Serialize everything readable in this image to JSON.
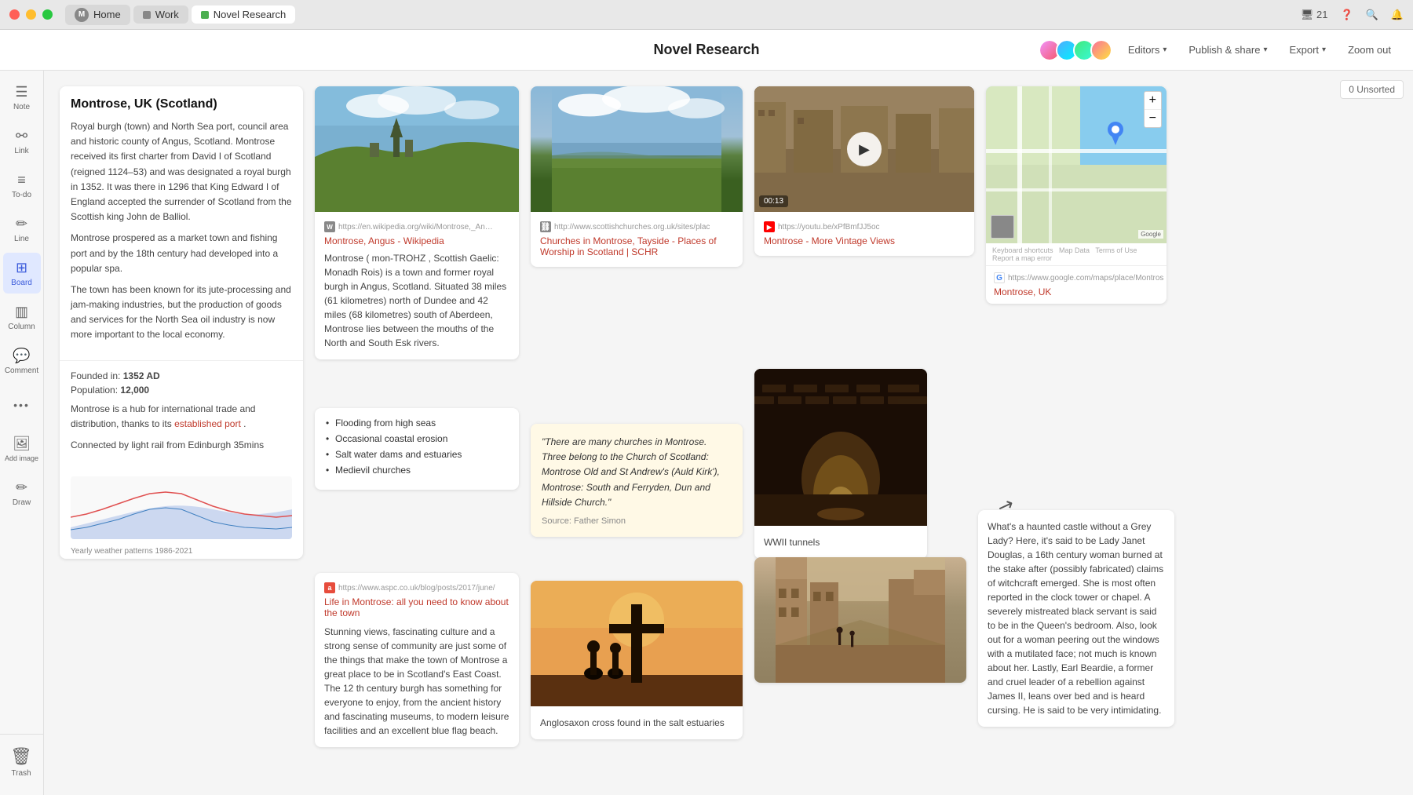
{
  "titlebar": {
    "tabs": [
      {
        "id": "home",
        "label": "Home",
        "type": "home",
        "active": false
      },
      {
        "id": "work",
        "label": "Work",
        "type": "square",
        "active": false
      },
      {
        "id": "novel",
        "label": "Novel Research",
        "type": "square-green",
        "active": true
      }
    ],
    "right": {
      "notifications": "21",
      "help": "?",
      "search": "🔍",
      "bell": "🔔"
    }
  },
  "app": {
    "title": "Novel Research",
    "editors_label": "Editors",
    "publish_label": "Publish & share",
    "export_label": "Export",
    "zoom_label": "Zoom out"
  },
  "sidebar": {
    "items": [
      {
        "id": "note",
        "icon": "☰",
        "label": "Note"
      },
      {
        "id": "link",
        "icon": "🔗",
        "label": "Link"
      },
      {
        "id": "todo",
        "icon": "☑",
        "label": "To-do"
      },
      {
        "id": "line",
        "icon": "✏️",
        "label": "Line"
      },
      {
        "id": "board",
        "icon": "⊞",
        "label": "Board",
        "active": true
      },
      {
        "id": "column",
        "icon": "▥",
        "label": "Column"
      },
      {
        "id": "comment",
        "icon": "💬",
        "label": "Comment"
      },
      {
        "id": "more",
        "icon": "•••",
        "label": ""
      },
      {
        "id": "image",
        "icon": "🖼",
        "label": "Add image"
      },
      {
        "id": "draw",
        "icon": "✏",
        "label": "Draw"
      }
    ]
  },
  "board": {
    "unsorted_label": "0 Unsorted"
  },
  "cards": {
    "montrose_info": {
      "title": "Montrose, UK (Scotland)",
      "body1": "Royal burgh (town) and North Sea port, council area and historic county of Angus, Scotland. Montrose received its first charter from David I of Scotland (reigned 1124–53) and was designated a royal burgh in 1352. It was there in 1296 that King Edward I of England accepted the surrender of Scotland from the Scottish king John de Balliol.",
      "body2": "Montrose prospered as a market town and fishing port and by the 18th century had developed into a popular spa.",
      "body3": "The town has been known for its jute-processing and jam-making industries, but the production of goods and services for the North Sea oil industry is now more important to the local economy.",
      "founded_label": "Founded in:",
      "founded_value": "1352 AD",
      "population_label": "Population:",
      "population_value": "12,000",
      "hub_text": "Montrose is a hub for international trade and distribution, thanks to its",
      "hub_link": "established port",
      "hub_end": ".",
      "rail_text": "Connected by light rail from Edinburgh 35mins",
      "chart_label": "Yearly weather patterns 1986-2021"
    },
    "wikipedia": {
      "source_url": "https://en.wikipedia.org/wiki/Montrose,_Angus",
      "link_text": "Montrose, Angus - Wikipedia",
      "body": "Montrose ( mon-TROHZ , Scottish Gaelic: Monadh Rois) is a town and former royal burgh in Angus, Scotland. Situated 38 miles (61 kilometres) north of Dundee and 42 miles (68 kilometres) south of Aberdeen, Montrose lies between the mouths of the North and South Esk rivers."
    },
    "churches_img": {
      "caption": ""
    },
    "vintage": {
      "youtube_url": "https://youtu.be/xPfBmfJJ5oc",
      "link_text": "Montrose - More Vintage Views",
      "play_button": "▶"
    },
    "map_google": {
      "url": "https://www.google.com/maps/place/Montros",
      "link_text": "Montrose, UK",
      "controls": [
        "+",
        "−"
      ]
    },
    "flooding": {
      "items": [
        "Flooding from high seas",
        "Occasional coastal erosion",
        "Salt water dams and estuaries",
        "Medievil churches"
      ]
    },
    "churches_link": {
      "icon_label": "W",
      "source_url": "http://www.scottishchurches.org.uk/sites/plac",
      "link_text": "Churches in Montrose, Tayside - Places of Worship in Scotland | SCHR"
    },
    "quote": {
      "text": "\"There are many churches in Montrose. Three belong to the Church of Scotland: Montrose Old and St Andrew's (Auld Kirk'), Montrose: South and Ferryden, Dun and Hillside Church.\"",
      "source": "Source: Father Simon"
    },
    "wwii": {
      "caption": "WWII tunnels"
    },
    "cross": {
      "caption": "Anglosaxon cross found in the salt estuaries"
    },
    "old_street": {
      "caption": ""
    },
    "aspc": {
      "source_url": "https://www.aspc.co.uk/blog/posts/2017/june/",
      "link_text": "Life in Montrose: all you need to know about the town",
      "body": "Stunning views, fascinating culture and a strong sense of community are just some of the things that make the town of Montrose a great place to be in Scotland's East Coast. The 12 th century burgh has something for everyone to enjoy, from the ancient history and fascinating museums, to modern leisure facilities and an excellent blue flag beach."
    },
    "ghost": {
      "text": "What's a haunted castle without a Grey Lady? Here, it's said to be Lady Janet Douglas, a 16th century woman burned at the stake after (possibly fabricated) claims of witchcraft emerged. She is most often reported in the clock tower or chapel. A severely mistreated black servant is said to be in the Queen's bedroom. Also, look out for a woman peering out the windows with a mutilated face; not much is known about her. Lastly, Earl Beardie, a former and cruel leader of a rebellion against James II, leans over bed and is heard cursing. He is said to be very intimidating."
    }
  },
  "trash": {
    "label": "Trash",
    "icon": "🗑"
  }
}
